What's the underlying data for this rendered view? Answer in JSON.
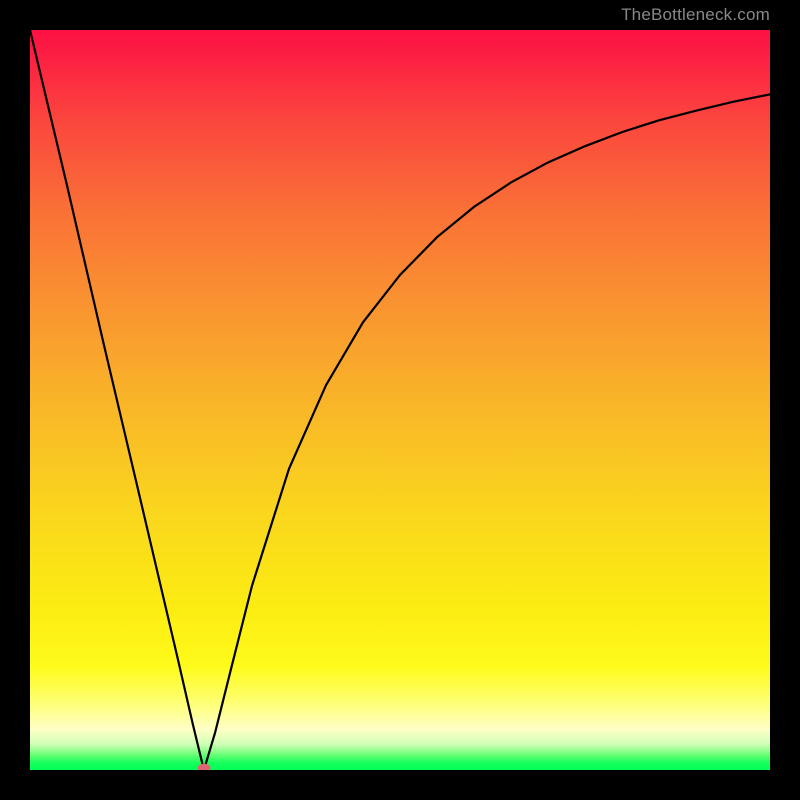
{
  "watermark": "TheBottleneck.com",
  "colors": {
    "frame_background": "#000000",
    "curve_stroke": "#000000",
    "marker_fill": "#de6572",
    "watermark_text": "#888888"
  },
  "chart_data": {
    "type": "line",
    "title": "",
    "xlabel": "",
    "ylabel": "",
    "xlim": [
      0,
      1
    ],
    "ylim": [
      0,
      1
    ],
    "description": "V-shaped bottleneck curve. y represents mismatch (1 = worst/red top, 0 = best/green bottom). Minimum at x ≈ 0.235.",
    "background_gradient_stops": [
      {
        "pos": 0.0,
        "color": "#fd1043"
      },
      {
        "pos": 0.38,
        "color": "#f99630"
      },
      {
        "pos": 0.66,
        "color": "#fad81d"
      },
      {
        "pos": 0.9,
        "color": "#feff63"
      },
      {
        "pos": 1.0,
        "color": "#00ff55"
      }
    ],
    "series": [
      {
        "name": "bottleneck-curve",
        "x": [
          0.0,
          0.05,
          0.1,
          0.15,
          0.2,
          0.22,
          0.235,
          0.25,
          0.27,
          0.3,
          0.35,
          0.4,
          0.45,
          0.5,
          0.55,
          0.6,
          0.65,
          0.7,
          0.75,
          0.8,
          0.85,
          0.9,
          0.95,
          1.0
        ],
        "y": [
          1.0,
          0.79,
          0.574,
          0.362,
          0.149,
          0.062,
          0.0,
          0.05,
          0.13,
          0.249,
          0.407,
          0.52,
          0.605,
          0.669,
          0.72,
          0.761,
          0.794,
          0.821,
          0.843,
          0.862,
          0.878,
          0.891,
          0.903,
          0.913
        ]
      }
    ],
    "marker": {
      "x": 0.235,
      "y": 0.003
    }
  }
}
